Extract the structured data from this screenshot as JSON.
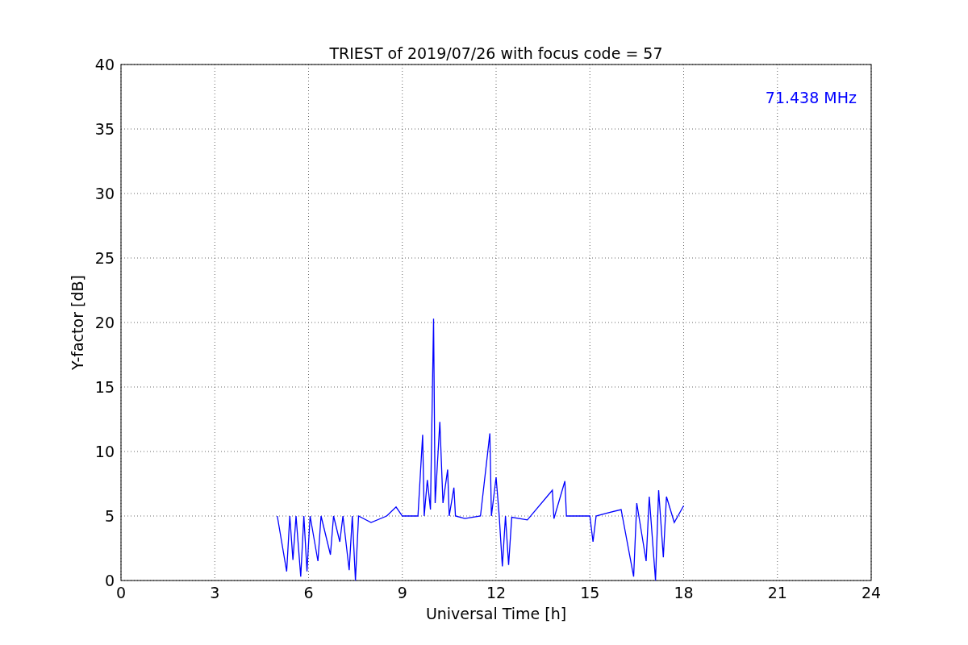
{
  "chart_data": {
    "type": "line",
    "title": "TRIEST of 2019/07/26 with focus code = 57",
    "xlabel": "Universal Time [h]",
    "ylabel": "Y-factor [dB]",
    "x": [
      5.0,
      5.3,
      5.4,
      5.5,
      5.6,
      5.75,
      5.85,
      5.95,
      6.05,
      6.3,
      6.4,
      6.7,
      6.8,
      7.0,
      7.1,
      7.3,
      7.4,
      7.5,
      7.6,
      8.0,
      8.5,
      8.8,
      9.0,
      9.5,
      9.65,
      9.7,
      9.8,
      9.9,
      10.0,
      10.05,
      10.2,
      10.3,
      10.45,
      10.5,
      10.65,
      10.7,
      11.0,
      11.5,
      11.8,
      11.85,
      12.0,
      12.1,
      12.2,
      12.3,
      12.4,
      12.5,
      13.0,
      13.8,
      13.85,
      14.2,
      14.25,
      15.0,
      15.1,
      15.2,
      15.5,
      16.0,
      16.4,
      16.5,
      16.8,
      16.9,
      17.1,
      17.2,
      17.35,
      17.45,
      17.7,
      18.0
    ],
    "series": [
      {
        "name": "71.438 MHz",
        "color": "#0000ff",
        "values": [
          5,
          0.7,
          5,
          1.6,
          5,
          0.3,
          5,
          0.7,
          5,
          1.5,
          5,
          2,
          5,
          3,
          5,
          0.8,
          5,
          0,
          5,
          4.5,
          5,
          5.7,
          5,
          5,
          11.3,
          5,
          7.8,
          5.5,
          20.3,
          6,
          12.3,
          6,
          8.6,
          5,
          7.2,
          5,
          4.8,
          5,
          11.4,
          5,
          8,
          5,
          1.1,
          5,
          1.2,
          4.9,
          4.7,
          7.0,
          4.8,
          7.7,
          5,
          5,
          3,
          5,
          5.2,
          5.5,
          0.3,
          6,
          1.5,
          6.5,
          0,
          7,
          1.8,
          6.5,
          4.5,
          5.8
        ]
      }
    ],
    "xlim": [
      0,
      24
    ],
    "ylim": [
      0,
      40
    ],
    "xticks": [
      0,
      3,
      6,
      9,
      12,
      15,
      18,
      21,
      24
    ],
    "yticks": [
      0,
      5,
      10,
      15,
      20,
      25,
      30,
      35,
      40
    ],
    "grid": true
  }
}
